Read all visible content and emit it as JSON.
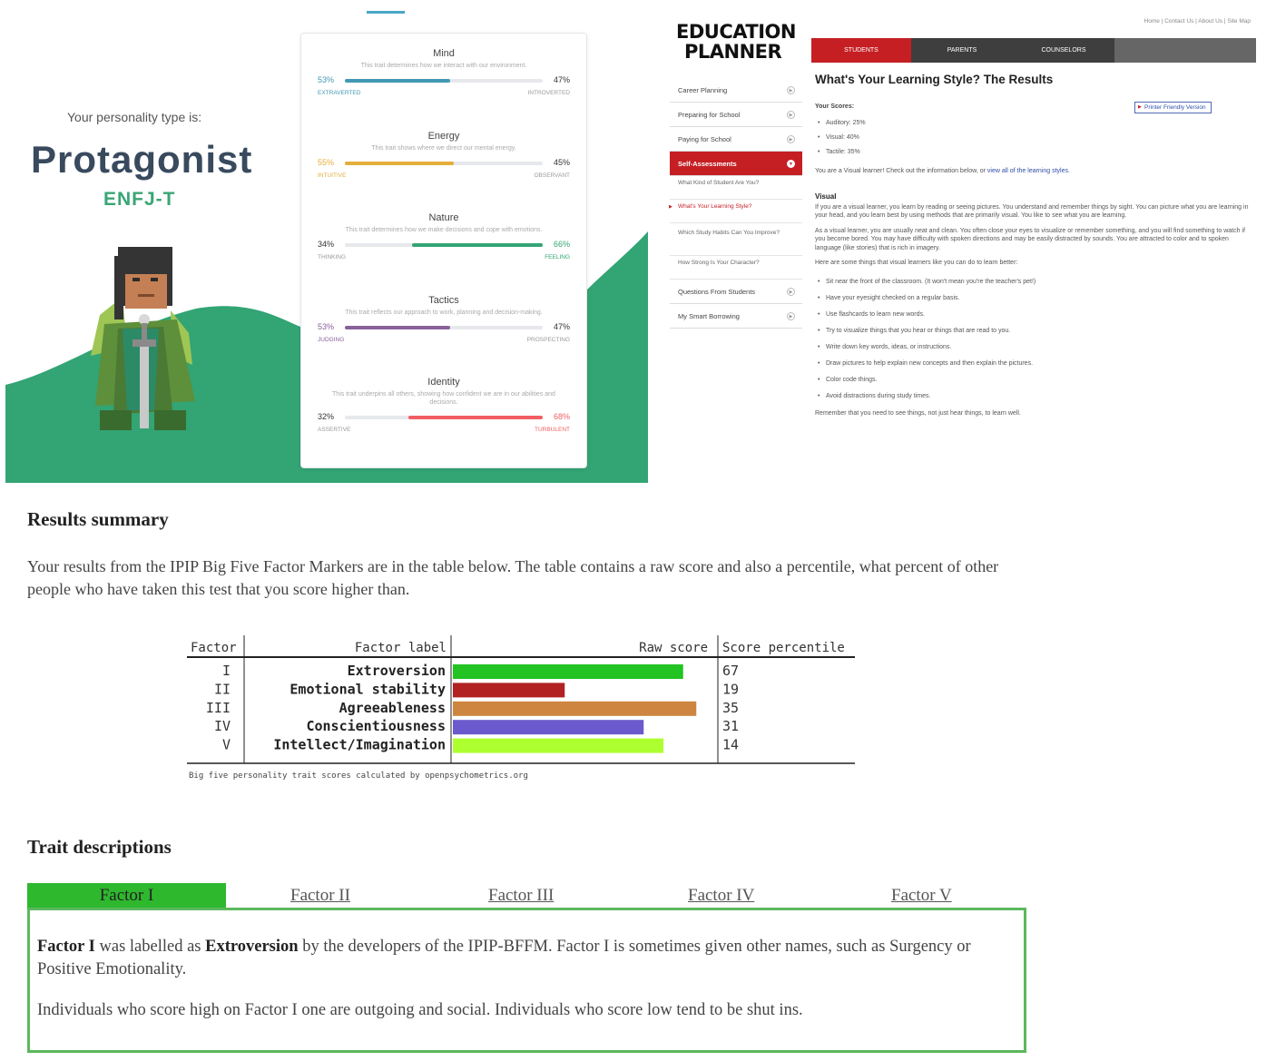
{
  "personality": {
    "label": "Your personality type is:",
    "name": "Protagonist",
    "code": "ENFJ-T",
    "colors": {
      "green": "#33a474",
      "title": "#394a5e"
    },
    "traits": [
      {
        "title": "Mind",
        "desc": "This trait determines how we interact with our environment.",
        "left_pct": "53%",
        "right_pct": "47%",
        "left_label": "EXTRAVERTED",
        "right_label": "INTROVERTED",
        "value": 53,
        "side": "left",
        "color": "#4298b4"
      },
      {
        "title": "Energy",
        "desc": "This trait shows where we direct our mental energy.",
        "left_pct": "55%",
        "right_pct": "45%",
        "left_label": "INTUITIVE",
        "right_label": "OBSERVANT",
        "value": 55,
        "side": "left",
        "color": "#e4ae3a"
      },
      {
        "title": "Nature",
        "desc": "This trait determines how we make decisions and cope with emotions.",
        "left_pct": "34%",
        "right_pct": "66%",
        "left_label": "THINKING",
        "right_label": "FEELING",
        "value": 66,
        "side": "right",
        "color": "#33a474"
      },
      {
        "title": "Tactics",
        "desc": "This trait reflects our approach to work, planning and decision-making.",
        "left_pct": "53%",
        "right_pct": "47%",
        "left_label": "JUDGING",
        "right_label": "PROSPECTING",
        "value": 53,
        "side": "left",
        "color": "#88619a"
      },
      {
        "title": "Identity",
        "desc": "This trait underpins all others, showing how confident we are in our abilities and decisions.",
        "left_pct": "32%",
        "right_pct": "68%",
        "left_label": "ASSERTIVE",
        "right_label": "TURBULENT",
        "value": 68,
        "side": "right",
        "color": "#f25e62"
      }
    ]
  },
  "planner": {
    "logo_line1": "EDUCATION",
    "logo_line2": "PLANNER",
    "toplinks": "Home | Contact Us | About Us | Site Map",
    "nav": [
      "STUDENTS",
      "PARENTS",
      "COUNSELORS"
    ],
    "sidebar": {
      "top": [
        "Career Planning",
        "Preparing for School",
        "Paying for School"
      ],
      "active": "Self-Assessments",
      "sub": [
        "What Kind of Student Are You?",
        "What's Your Learning Style?",
        "Which Study Habits Can You Improve?",
        "How Strong Is Your Character?"
      ],
      "bottom": [
        "Questions From Students",
        "My Smart Borrowing"
      ]
    },
    "title": "What's Your Learning Style? The Results",
    "scores_label": "Your Scores:",
    "print_label": "Printer Friendly Version",
    "scores": [
      "Auditory: 25%",
      "Visual: 40%",
      "Tactile: 35%"
    ],
    "visual_line_a": "You are a Visual learner! Check out the information below, or",
    "visual_link": "view all of the learning styles.",
    "section": "Visual",
    "para1": "If you are a visual learner, you learn by reading or seeing pictures. You understand and remember things by sight. You can picture what you are learning in your head, and you learn best by using methods that are primarily visual. You like to see what you are learning.",
    "para2": "As a visual learner, you are usually neat and clean. You often close your eyes to visualize or remember something, and you will find something to watch if you become bored. You may have difficulty with spoken directions and may be easily distracted by sounds. You are attracted to color and to spoken language (like stories) that is rich in imagery.",
    "para3": "Here are some things that visual learners like you can do to learn better:",
    "tips": [
      "Sit near the front of the classroom. (It won't mean you're the teacher's pet!)",
      "Have your eyesight checked on a regular basis.",
      "Use flashcards to learn new words.",
      "Try to visualize things that you hear or things that are read to you.",
      "Write down key words, ideas, or instructions.",
      "Draw pictures to help explain new concepts and then explain the pictures.",
      "Color code things.",
      "Avoid distractions during study times."
    ],
    "closing": "Remember that you need to see things, not just hear things, to learn well."
  },
  "ipip": {
    "summary_heading": "Results summary",
    "intro": "Your results from the IPIP Big Five Factor Markers are in the table below. The table contains a raw score and also a percentile, what percent of other people who have taken this test that you score higher than.",
    "trait_heading": "Trait descriptions",
    "tabs": [
      "Factor I",
      "Factor II",
      "Factor III",
      "Factor IV",
      "Factor V"
    ],
    "desc_p1_a": "Factor I",
    "desc_p1_b": " was labelled as ",
    "desc_p1_c": "Extroversion",
    "desc_p1_d": " by the developers of the IPIP-BFFM. Factor I is sometimes given other names, such as Surgency or Positive Emotionality.",
    "desc_p2": "Individuals who score high on Factor I one are outgoing and social. Individuals who score low tend to be shut ins."
  },
  "chart_data": {
    "type": "bar",
    "orientation": "horizontal",
    "headers": [
      "Factor",
      "Factor label",
      "Raw score",
      "Score percentile"
    ],
    "numerals": [
      "I",
      "II",
      "III",
      "IV",
      "V"
    ],
    "categories": [
      "Extroversion",
      "Emotional stability",
      "Agreeableness",
      "Conscientiousness",
      "Intellect/Imagination"
    ],
    "values": [
      67,
      19,
      35,
      31,
      14
    ],
    "raw_scores": [
      35,
      17,
      37,
      29,
      32
    ],
    "raw_scale_max": 40,
    "colors": [
      "#22c322",
      "#b22222",
      "#cd853f",
      "#6a5acd",
      "#adff2f"
    ],
    "caption": "Big five personality trait scores calculated by openpsychometrics.org"
  }
}
